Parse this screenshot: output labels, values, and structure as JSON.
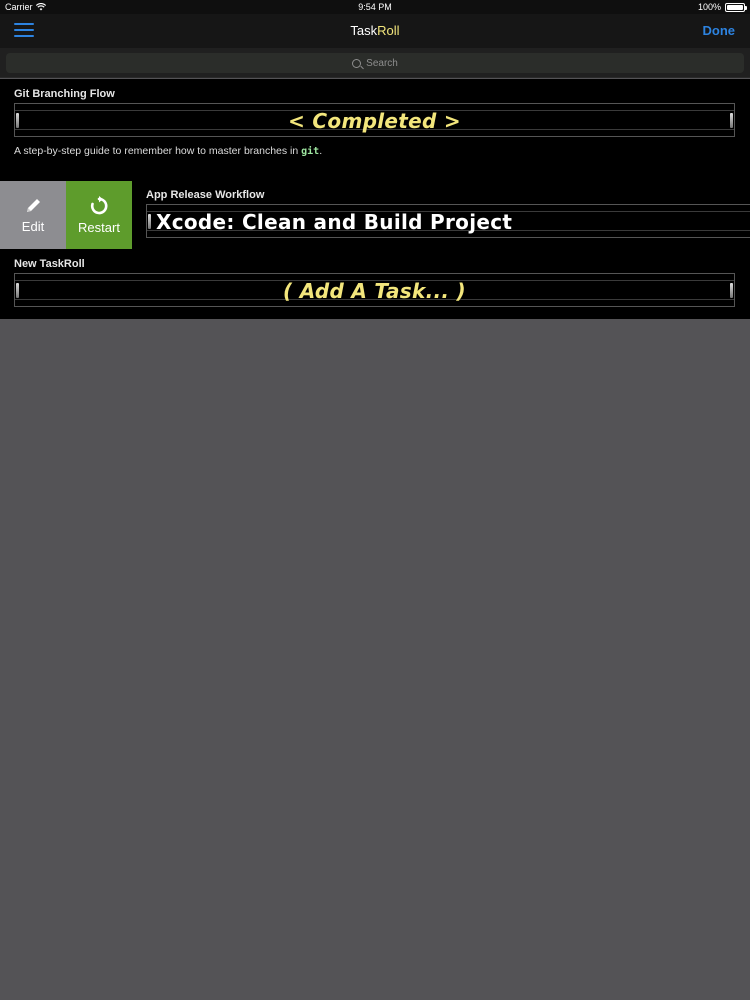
{
  "status_bar": {
    "carrier": "Carrier",
    "time": "9:54 PM",
    "battery": "100%",
    "battery_level": 1.0
  },
  "nav": {
    "title_part1": "Task",
    "title_part2": "Roll",
    "done_label": "Done",
    "menu_icon": "hamburger-menu-icon"
  },
  "search": {
    "placeholder": "Search"
  },
  "taskrolls": [
    {
      "title": "Git Branching Flow",
      "current_task": "< Completed >",
      "description_prefix": "A step-by-step guide to remember how to master branches in ",
      "description_code": "git",
      "description_suffix": "."
    },
    {
      "title": "App Release Workflow",
      "current_task": "Xcode: Clean and Build Project",
      "actions": {
        "edit_label": "Edit",
        "restart_label": "Restart",
        "edit_icon": "pencil-icon",
        "restart_icon": "restart-icon"
      }
    },
    {
      "title": "New TaskRoll",
      "current_task": "( Add A Task... )"
    }
  ],
  "colors": {
    "accent_blue": "#2d83e0",
    "task_yellow": "#f3e67c",
    "restart_green": "#5e9c2c",
    "edit_gray": "#8d8d91",
    "background": "#545356"
  }
}
